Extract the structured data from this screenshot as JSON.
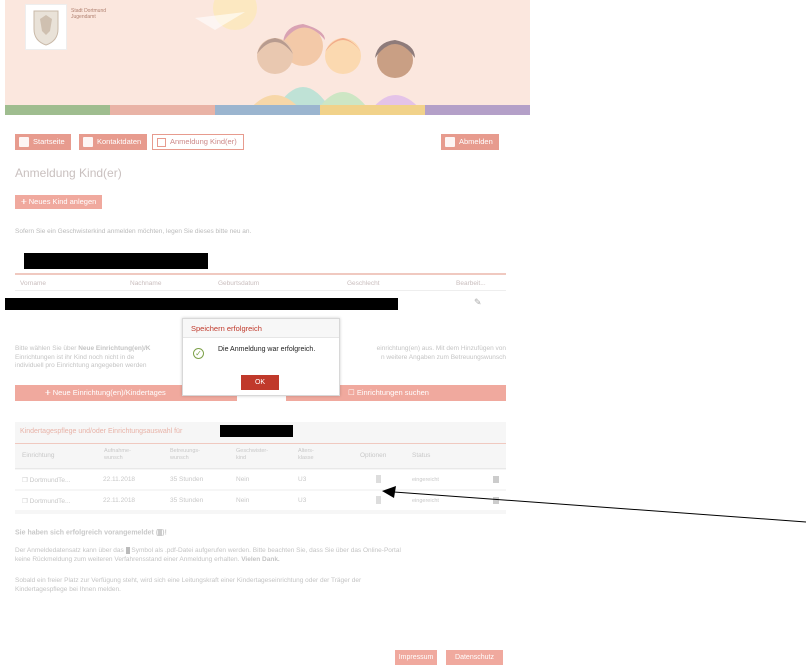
{
  "banner": {
    "city_line1": "Stadt Dortmund",
    "city_line2": "Jugendamt",
    "colors": {
      "background": "#fbe7de",
      "strip": [
        "#9fbd8f",
        "#e9b3a6",
        "#9bb5cf",
        "#f1d28a",
        "#b4a0c8"
      ]
    }
  },
  "nav": {
    "startseite": "Startseite",
    "kontaktdaten": "Kontaktdaten",
    "anmeldung": "Anmeldung Kind(er)",
    "abmelden": "Abmelden",
    "icons": [
      "home-icon",
      "lock-icon",
      "document-icon",
      "lock-icon"
    ]
  },
  "page": {
    "title": "Anmeldung Kind(er)",
    "new_child_button": "Neues Kind anlegen",
    "hint": "Sofern Sie ein Geschwisterkind anmelden möchten, legen Sie dieses bitte neu an."
  },
  "children_table": {
    "columns": [
      "Vorname",
      "Nachname",
      "Geburtsdatum",
      "Geschlecht",
      "Bearbeit..."
    ]
  },
  "info": {
    "line1_a": "Bitte wählen Sie über ",
    "line1_bold": "Neue Einrichtung(en)/K",
    "line1_b": "einrichtung(en) aus. Mit dem Hinzufügen von",
    "line2_a": "Einrichtungen ist ihr Kind noch nicht in de",
    "line2_b": "n weitere Angaben zum Betreuungswunsch",
    "line3": "individuell pro Einrichtung angegeben werden"
  },
  "actions": {
    "new_facility": "Neue Einrichtung(en)/Kindertages",
    "search_facilities": "Einrichtungen suchen"
  },
  "selection": {
    "title": "Kindertagespflege und/oder Einrichtungsauswahl für",
    "columns": [
      "Einrichtung",
      "Aufnahme-\nwunsch",
      "Betreuungs-\nwunsch",
      "Geschwister-\nkind",
      "Alters-\nklasse",
      "Optionen",
      "Status"
    ],
    "rows": [
      {
        "einrichtung": "DortmundTe...",
        "aufnahme": "22.11.2018",
        "betreuung": "35 Stunden",
        "geschwister": "Nein",
        "alter": "U3",
        "status": "eingereicht"
      },
      {
        "einrichtung": "DortmundTe...",
        "aufnahme": "22.11.2018",
        "betreuung": "35 Stunden",
        "geschwister": "Nein",
        "alter": "U3",
        "status": "eingereicht"
      }
    ]
  },
  "success": {
    "heading": "Sie haben sich erfolgreich vorangemeldet (",
    "heading_end": ")!",
    "para1_line1": "Der Anmeldedatensatz kann über das ",
    "para1_line1b": " Symbol als .pdf-Datei aufgerufen werden. Bitte beachten Sie, dass Sie über das Online-Portal",
    "para1_line2": "keine Rückmeldung zum weiteren Verfahrensstand einer Anmeldung erhalten. ",
    "para1_thanks": "Vielen Dank.",
    "para2_line1": "Sobald ein freier Platz zur Verfügung steht, wird sich eine Leitungskraft einer Kindertageseinrichtung oder der Träger der",
    "para2_line2": "Kindertagespflege bei Ihnen melden."
  },
  "footer": {
    "impressum": "Impressum",
    "datenschutz": "Datenschutz"
  },
  "dialog": {
    "title": "Speichern erfolgreich",
    "message": "Die Anmeldung war erfolgreich.",
    "ok": "OK",
    "colors": {
      "title": "#c0392b",
      "ok_bg": "#c0392b",
      "check": "#7da14a"
    }
  }
}
